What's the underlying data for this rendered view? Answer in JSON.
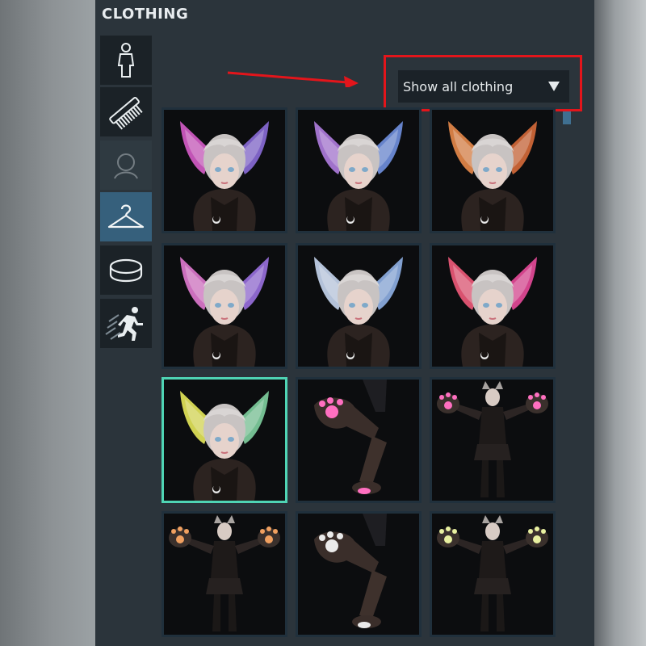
{
  "panel": {
    "title": "CLOTHING"
  },
  "sidebar": {
    "items": [
      {
        "name": "body",
        "icon": "body-icon"
      },
      {
        "name": "hair",
        "icon": "comb-icon"
      },
      {
        "name": "face",
        "icon": "head-outline-icon"
      },
      {
        "name": "clothing",
        "icon": "hanger-icon",
        "active": true
      },
      {
        "name": "accessories",
        "icon": "ring-icon"
      },
      {
        "name": "animation",
        "icon": "running-figure-icon"
      }
    ]
  },
  "filter": {
    "selected": "Show all clothing",
    "highlight_color": "#e3151b"
  },
  "items": [
    {
      "kind": "ears",
      "accent": "#d65cc9",
      "accent2": "#8a6bd8"
    },
    {
      "kind": "ears",
      "accent": "#b07de0",
      "accent2": "#7090e0"
    },
    {
      "kind": "ears",
      "accent": "#e88a4a",
      "accent2": "#d66a3a"
    },
    {
      "kind": "ears",
      "accent": "#e07ad0",
      "accent2": "#9a70e0"
    },
    {
      "kind": "ears",
      "accent": "#c6d6f0",
      "accent2": "#8fb0e6"
    },
    {
      "kind": "ears",
      "accent": "#f05a7a",
      "accent2": "#e84a9a"
    },
    {
      "kind": "ears",
      "accent": "#e6e85a",
      "accent2": "#7fd0a0",
      "selected": true
    },
    {
      "kind": "paw-closeup",
      "accent": "#ff6fc0"
    },
    {
      "kind": "paws-figure",
      "accent": "#ff6fc0"
    },
    {
      "kind": "paws-figure",
      "accent": "#f0a060"
    },
    {
      "kind": "paw-closeup",
      "accent": "#eaeaea"
    },
    {
      "kind": "paws-figure",
      "accent": "#e8f0a0"
    }
  ],
  "colors": {
    "panel_bg": "#2b343b",
    "selected_border": "#4fd4b4",
    "active_category": "#36607c"
  }
}
